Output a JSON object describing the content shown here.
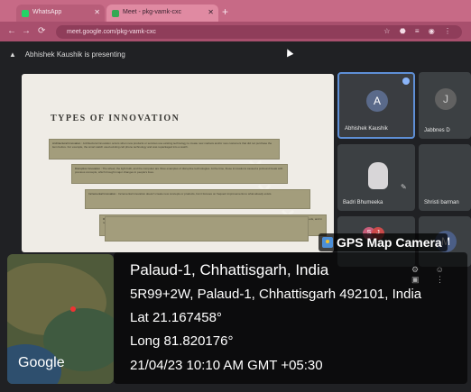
{
  "browser": {
    "tabs": [
      {
        "label": "WhatsApp",
        "favicon_color": "#25d366"
      },
      {
        "label": "Meet - pkg-vamk-cxc",
        "favicon_color": "#34a853"
      }
    ],
    "new_tab_label": "+",
    "url": "meet.google.com/pkg-vamk-cxc",
    "nav": {
      "back": "←",
      "forward": "→",
      "reload": "⟳"
    },
    "extensions": "☆ ⬣ ≡ ◉ ⋮"
  },
  "meet": {
    "presenting_text": "Abhishek Kaushik is presenting",
    "slide": {
      "title": "TYPES OF INNOVATION",
      "boxes": [
        {
          "lead": "Architectural Innovation :",
          "text": "Architectural innovation occurs when new products or services use existing technology to create new markets and/or new customers that did not purchase the item before. For example, the smart watch used existing cell phone technology and was repackaged into a watch."
        },
        {
          "lead": "Disruptive Innovation :",
          "text": "The wheel, the light bulb, and the computer are three examples of disruptive technologies. At the time, these innovations caused a profound break with previous concepts, which brought major changes in people's lives."
        },
        {
          "lead": "Incremental Innovation :",
          "text": "Incremental innovation doesn't create new concepts or products, but it focuses on frequent improvements to what already exists."
        },
        {
          "lead": "Radical Innovation :",
          "text": "Radical innovation has been around almost as long as there has been life on the planet. Examples include farming implements to improve farming methods, and in recent centuries, automobiles. All these examples were at one point a first in their technology, which caused change in our lives."
        }
      ]
    },
    "participants": [
      {
        "name": "Abhishek Kaushik",
        "initial": "A",
        "avatar_color": "#5a6a8a"
      },
      {
        "name": "Jabbnes D",
        "initial": "J"
      },
      {
        "name": "Badri Bhumeeka"
      },
      {
        "name": "Shristi barman"
      },
      {
        "name": "",
        "initials": [
          "S",
          "J"
        ]
      },
      {
        "name": "",
        "initial": "M"
      }
    ]
  },
  "gps": {
    "app_label": "GPS Map Camera",
    "place": "Palaud-1, Chhattisgarh, India",
    "address": "5R99+2W, Palaud-1, Chhattisgarh 492101, India",
    "lat": "Lat 21.167458°",
    "long": "Long 81.820176°",
    "datetime": "21/04/23 10:10 AM GMT +05:30",
    "map_logo": "Google"
  }
}
